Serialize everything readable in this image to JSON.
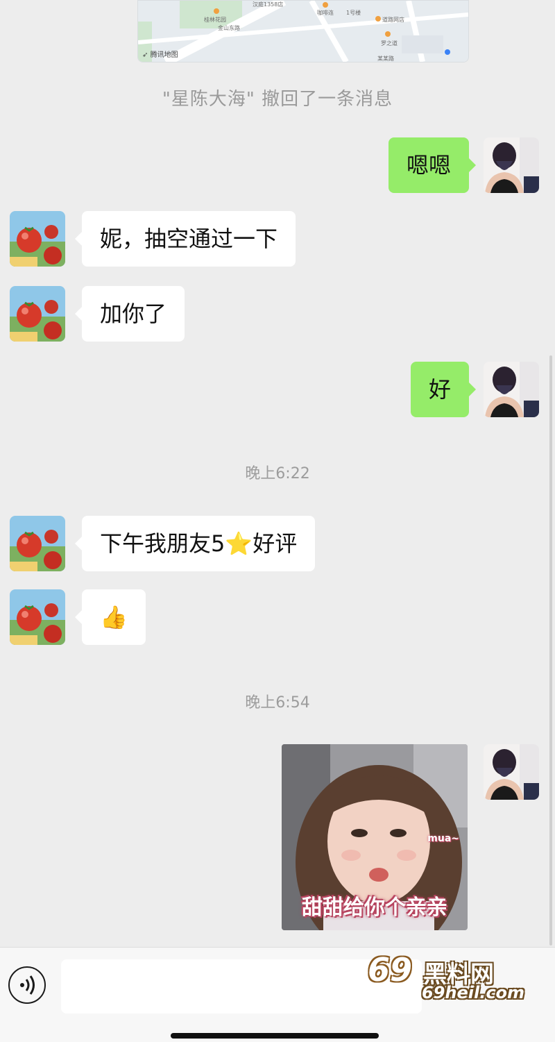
{
  "map": {
    "credit": "腾讯地图",
    "labels": [
      "汉庭1358店",
      "桂林花园",
      "金山东路",
      "咖啡连",
      "1号楼",
      "道路网店",
      "罗之道",
      "某某路"
    ]
  },
  "recall_notice": "\"星陈大海\" 撤回了一条消息",
  "messages": {
    "m1": "嗯嗯",
    "m2": "妮，抽空通过一下",
    "m3": "加你了",
    "m4": "好",
    "time1": "晚上6:22",
    "m5": "下午我朋友5⭐好评",
    "m6": "👍",
    "time2": "晚上6:54"
  },
  "sticker": {
    "caption": "甜甜给你个亲亲",
    "mua": "mua~"
  },
  "watermark": {
    "big": "69",
    "cn": "黑料网",
    "url": "69heil.com"
  },
  "colors": {
    "background": "#ededed",
    "outgoing_bubble": "#95ec69",
    "incoming_bubble": "#ffffff"
  },
  "icons": {
    "voice": "voice-icon",
    "thumbs_up": "thumbs-up-emoji",
    "star": "star-emoji"
  }
}
